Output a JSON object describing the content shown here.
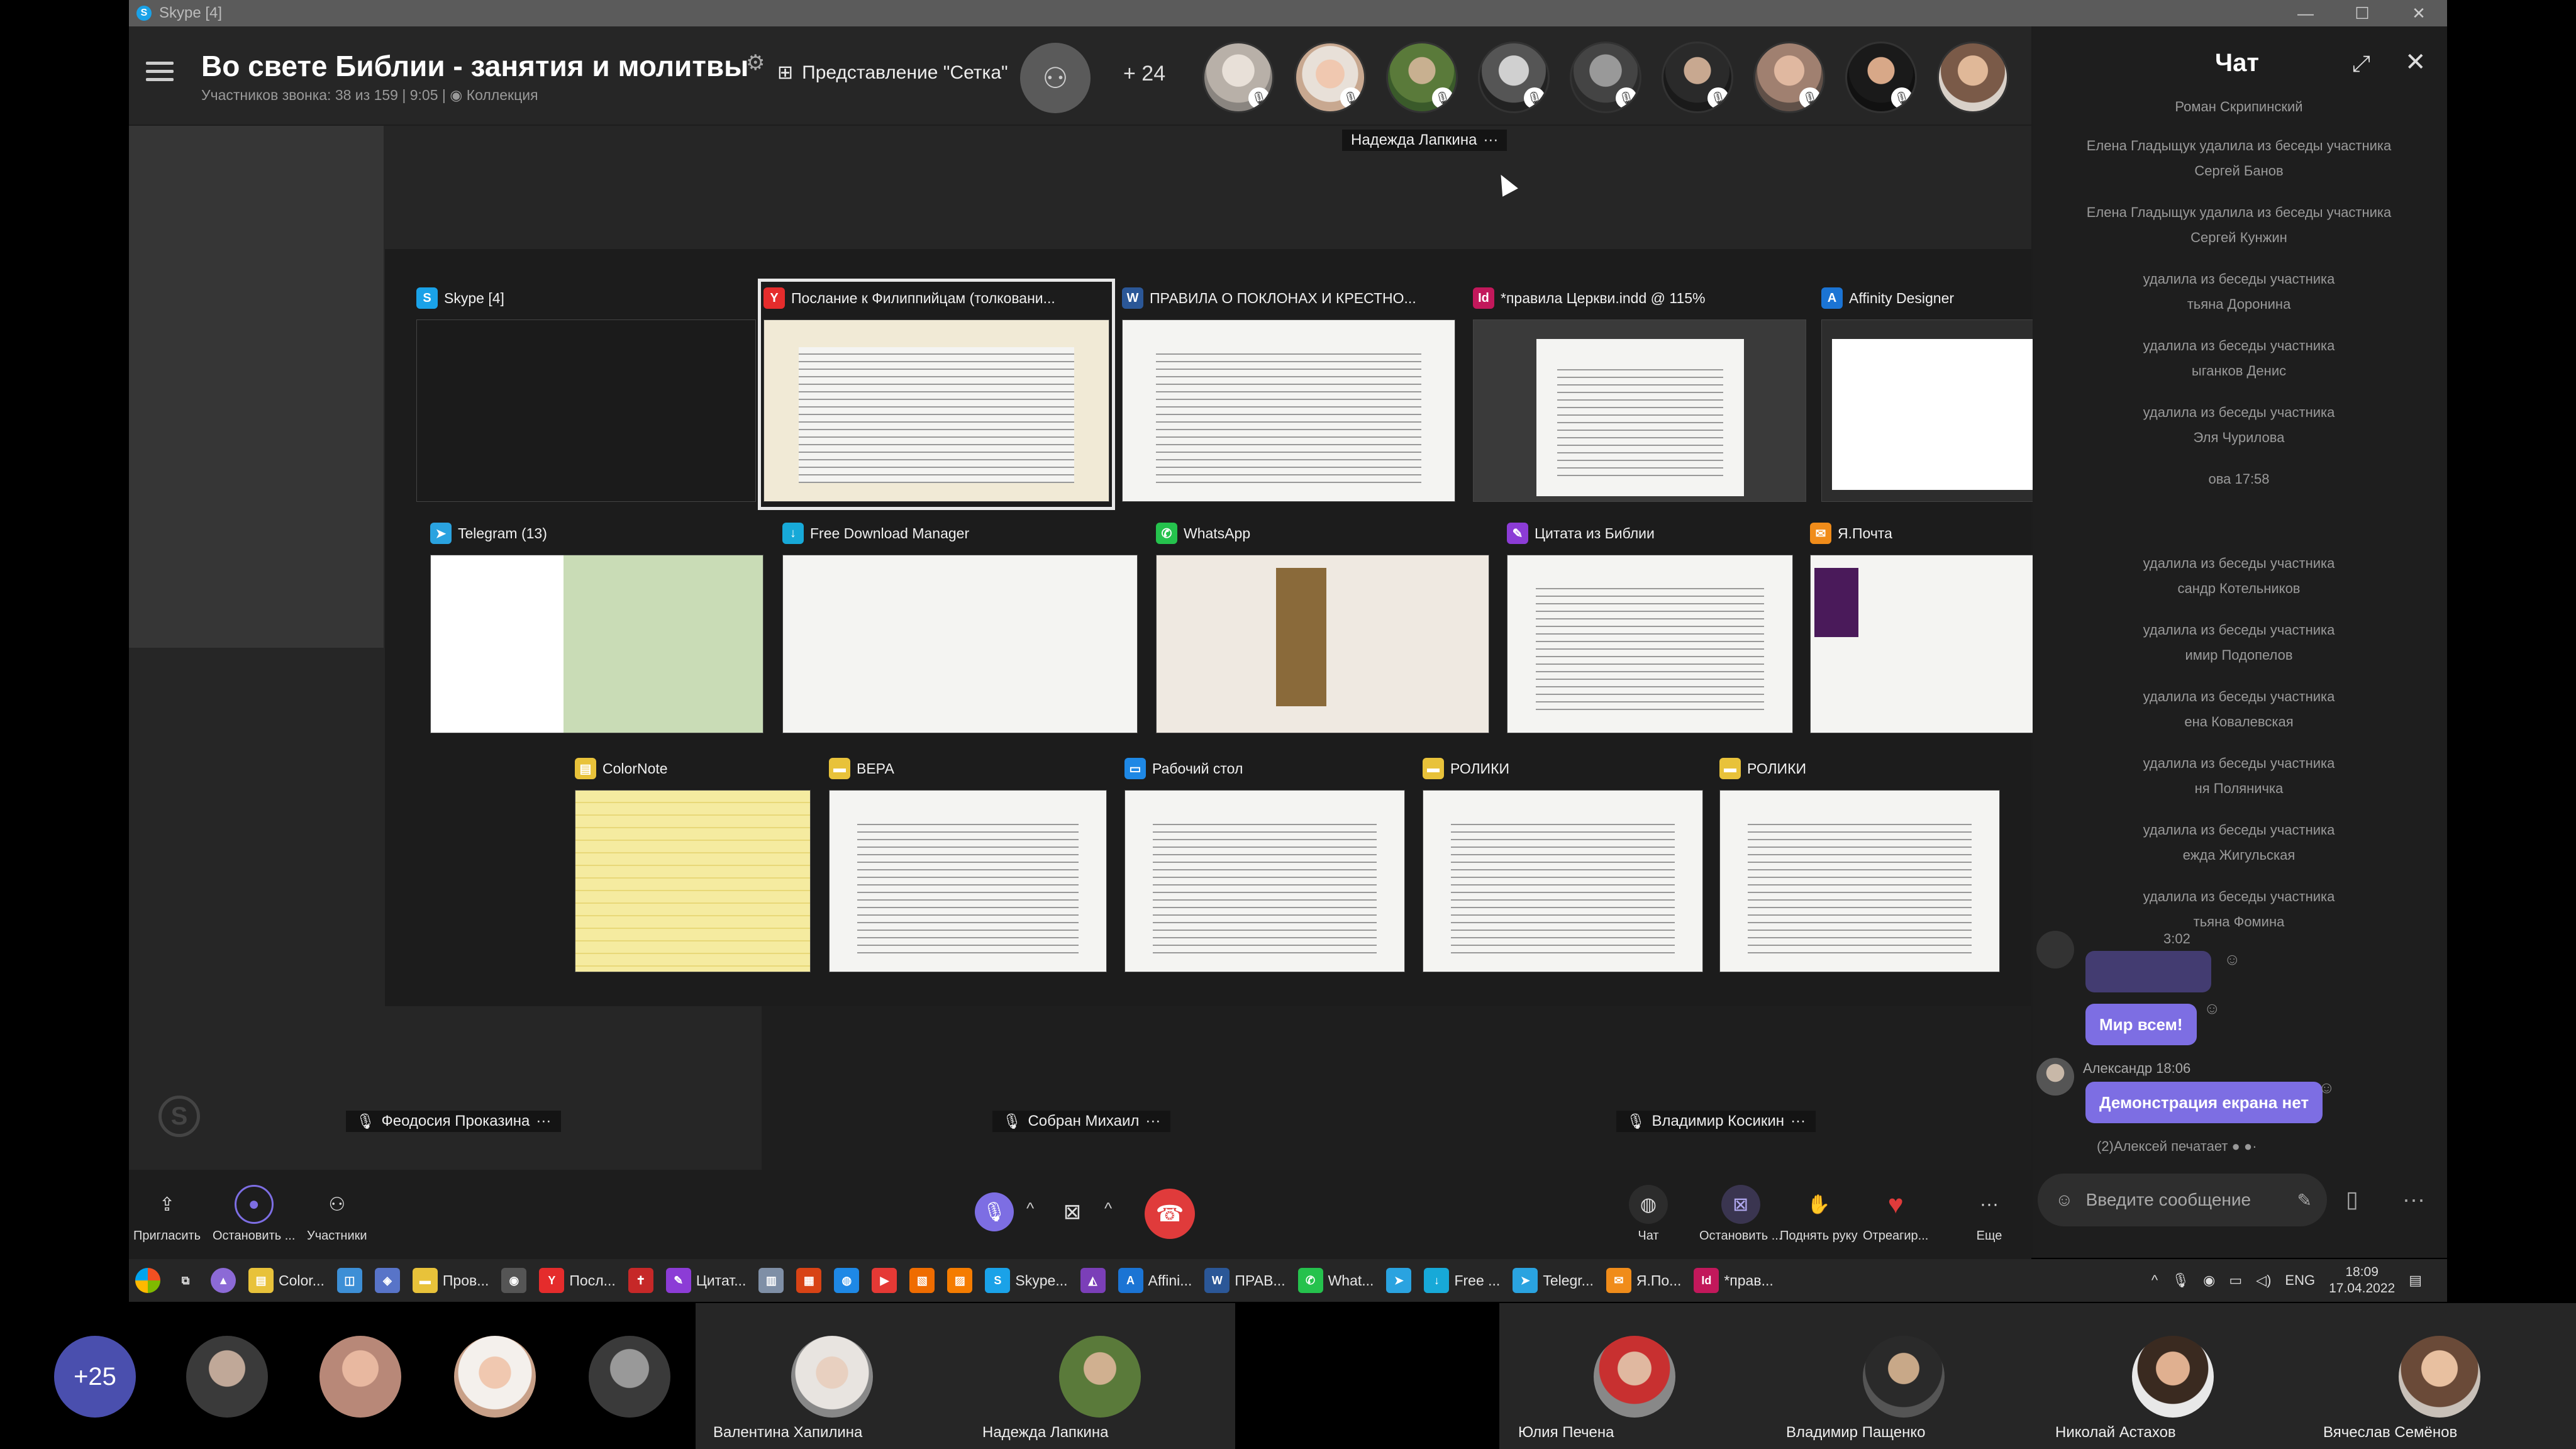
{
  "window": {
    "title": "Skype [4]"
  },
  "call": {
    "title": "Во свете Библии - занятия и молитвы",
    "subtitle": "Участников звонка: 38 из 159 | 9:05 |",
    "collection": "Коллекция",
    "grid_view_label": "Представление \"Сетка\"",
    "extra_participants": "+ 24",
    "speaker_name": "Надежда Лапкина"
  },
  "task_view": {
    "row1": [
      {
        "label": "Skype [4]",
        "icon": "skype-icon",
        "color": "#1aa2e8"
      },
      {
        "label": "Послание к Филиппийцам (толковани...",
        "icon": "yandex-browser-icon",
        "color": "#e52c2c"
      },
      {
        "label": "ПРАВИЛА О ПОКЛОНАХ И КРЕСТНО...",
        "icon": "word-icon",
        "color": "#2b5797"
      },
      {
        "label": "*правила Церкви.indd @ 115%",
        "icon": "indesign-icon",
        "color": "#c2185b"
      },
      {
        "label": "Affinity Designer",
        "icon": "affinity-designer-icon",
        "color": "#1b74d4"
      }
    ],
    "row2": [
      {
        "label": "Telegram (13)",
        "icon": "telegram-icon",
        "color": "#2aa3e0"
      },
      {
        "label": "Free Download Manager",
        "icon": "fdm-icon",
        "color": "#17a9d8"
      },
      {
        "label": "WhatsApp",
        "icon": "whatsapp-icon",
        "color": "#25c24d"
      },
      {
        "label": "Цитата из Библии",
        "icon": "bible-quote-icon",
        "color": "#8c3cd6"
      },
      {
        "label": "Я.Почта",
        "icon": "yandex-mail-icon",
        "color": "#f08c1a"
      }
    ],
    "row3": [
      {
        "label": "ColorNote",
        "icon": "colornote-icon",
        "color": "#e8c23a"
      },
      {
        "label": "ВЕРА",
        "icon": "folder-icon",
        "color": "#e8c23a"
      },
      {
        "label": "Рабочий стол",
        "icon": "desktop-icon",
        "color": "#1e88e5"
      },
      {
        "label": "РОЛИКИ",
        "icon": "folder-icon",
        "color": "#e8c23a"
      },
      {
        "label": "РОЛИКИ",
        "icon": "folder-icon",
        "color": "#e8c23a"
      }
    ]
  },
  "pane_names": {
    "left": "Феодосия Проказина",
    "center": "Собран Михаил",
    "right": "Владимир Косикин"
  },
  "chat": {
    "title": "Чат",
    "top_name": "Роман Скрипинский",
    "system_messages": [
      "Елена Гладыщук удалила из беседы участника",
      "Сергей Банов",
      "Елена Гладыщук удалила из беседы участника",
      "Сергей Кунжин",
      "удалила из беседы участника",
      "тьяна Доронина",
      "удалила из беседы участника",
      "ыганков Денис",
      "удалила из беседы участника",
      "Эля Чурилова",
      "ова 17:58",
      "удалила из беседы участника",
      "сандр Котельников",
      "удалила из беседы участника",
      "имир Подопелов",
      "удалила из беседы участника",
      "ена Ковалевская",
      "удалила из беседы участника",
      "ня Поляничка",
      "удалила из беседы участника",
      "ежда Жигульская",
      "удалила из беседы участника",
      "тьяна Фомина"
    ],
    "time_1": "3:02",
    "bubble_1": "Мир всем!",
    "sender_2": "Александр 18:06",
    "bubble_2": "Демонстрация екрана нет",
    "typing": "(2)Алексей печатает",
    "input_placeholder": "Введите сообщение"
  },
  "controls": {
    "invite": "Пригласить",
    "stop_left": "Остановить ...",
    "participants": "Участники",
    "chat": "Чат",
    "stop_right": "Остановить ...",
    "raise_hand": "Поднять руку",
    "react": "Отреагир...",
    "more": "Еще"
  },
  "taskbar": {
    "items": [
      {
        "label": "Color...",
        "icon": "colornote-icon",
        "color": "#e8c23a"
      },
      {
        "label": "",
        "icon": "skype-blue-icon",
        "color": "#3d8fd6"
      },
      {
        "label": "",
        "icon": "app-icon",
        "color": "#5874c8"
      },
      {
        "label": "Пров...",
        "icon": "folder-icon",
        "color": "#e8c23a"
      },
      {
        "label": "",
        "icon": "camera-icon",
        "color": "#555555"
      },
      {
        "label": "Посл...",
        "icon": "yandex-browser-icon",
        "color": "#e52c2c"
      },
      {
        "label": "",
        "icon": "cross-icon",
        "color": "#c62828"
      },
      {
        "label": "Цитат...",
        "icon": "bible-quote-icon",
        "color": "#8c3cd6"
      },
      {
        "label": "",
        "icon": "notes-icon",
        "color": "#7f8fa6"
      },
      {
        "label": "",
        "icon": "calendar-icon",
        "color": "#d84315"
      },
      {
        "label": "",
        "icon": "chat-icon",
        "color": "#1e88e5"
      },
      {
        "label": "",
        "icon": "video-icon",
        "color": "#e53935"
      },
      {
        "label": "",
        "icon": "grid-app-icon",
        "color": "#ef6c00"
      },
      {
        "label": "",
        "icon": "slides-icon",
        "color": "#f57c00"
      },
      {
        "label": "Skype...",
        "icon": "skype-icon",
        "color": "#1aa2e8"
      },
      {
        "label": "",
        "icon": "affinity-photo-icon",
        "color": "#7b3fb8"
      },
      {
        "label": "Affini...",
        "icon": "affinity-designer-icon",
        "color": "#1b74d4"
      },
      {
        "label": "ПРАВ...",
        "icon": "word-icon",
        "color": "#2b5797"
      },
      {
        "label": "What...",
        "icon": "whatsapp-icon",
        "color": "#25c24d"
      },
      {
        "label": "",
        "icon": "telegram-icon",
        "color": "#2aa3e0"
      },
      {
        "label": "Free ...",
        "icon": "fdm-icon",
        "color": "#17a9d8"
      },
      {
        "label": "Telegr...",
        "icon": "telegram-icon",
        "color": "#2aa3e0"
      },
      {
        "label": "Я.По...",
        "icon": "yandex-mail-icon",
        "color": "#f08c1a"
      },
      {
        "label": "*прав...",
        "icon": "indesign-icon",
        "color": "#c2185b"
      }
    ],
    "lang": "ENG",
    "time": "18:09",
    "date": "17.04.2022"
  },
  "strip": {
    "more_count": "+25",
    "names": [
      "Валентина Хапилина",
      "Надежда Лапкина",
      "Юлия Печена",
      "Владимир Пащенко",
      "Николай Астахов",
      "Вячеслав Семёнов"
    ]
  },
  "colors": {
    "accent": "#7d6ee3",
    "hangup": "#e03b3b",
    "mic": "#7d6ee3"
  }
}
